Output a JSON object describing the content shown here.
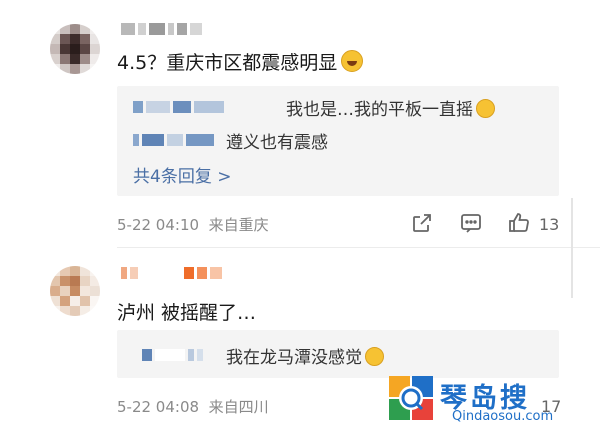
{
  "comments": [
    {
      "text": "4.5？重庆市区都震感明显",
      "replies": [
        {
          "text": "我也是…我的平板一直摇"
        },
        {
          "text": "遵义也有震感"
        }
      ],
      "more_replies": "共4条回复 >",
      "time": "5-22 04:10",
      "location": "来自重庆",
      "like_count": "13",
      "icons": [
        "share-icon",
        "comment-icon",
        "like-icon"
      ]
    },
    {
      "text": "泸州 被摇醒了…",
      "replies": [
        {
          "text": "我在龙马潭没感觉"
        }
      ],
      "time": "5-22 04:08",
      "location": "来自四川",
      "like_count": "17",
      "icons": [
        "like-icon"
      ]
    }
  ],
  "watermark": {
    "brand": "琴岛搜",
    "url": "Qindaosou.com"
  },
  "colors": {
    "link": "#4a6fa5",
    "meta": "#8a8a8a",
    "reply_bg": "#f4f4f4"
  }
}
